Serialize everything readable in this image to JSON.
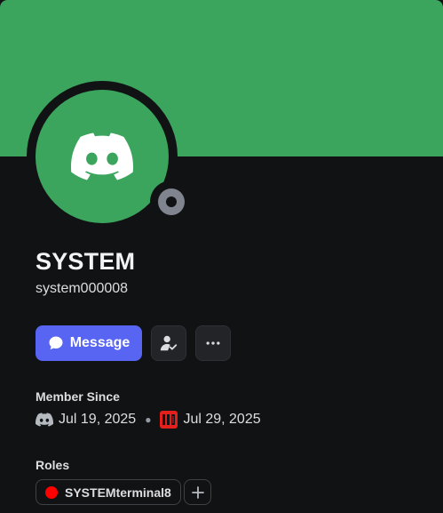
{
  "profile": {
    "display_name": "SYSTEM",
    "username": "system000008",
    "status": "offline"
  },
  "actions": {
    "message_label": "Message",
    "friend_icon": "friend-pending-icon",
    "more_icon": "more-dots-icon"
  },
  "member_since": {
    "title": "Member Since",
    "discord_date": "Jul 19, 2025",
    "server_date": "Jul 29, 2025"
  },
  "roles": {
    "title": "Roles",
    "items": [
      {
        "name": "SYSTEMterminal8",
        "color": "#ff0000"
      }
    ]
  },
  "colors": {
    "banner": "#3ba55d",
    "background": "#111214",
    "brand": "#5865f2"
  }
}
